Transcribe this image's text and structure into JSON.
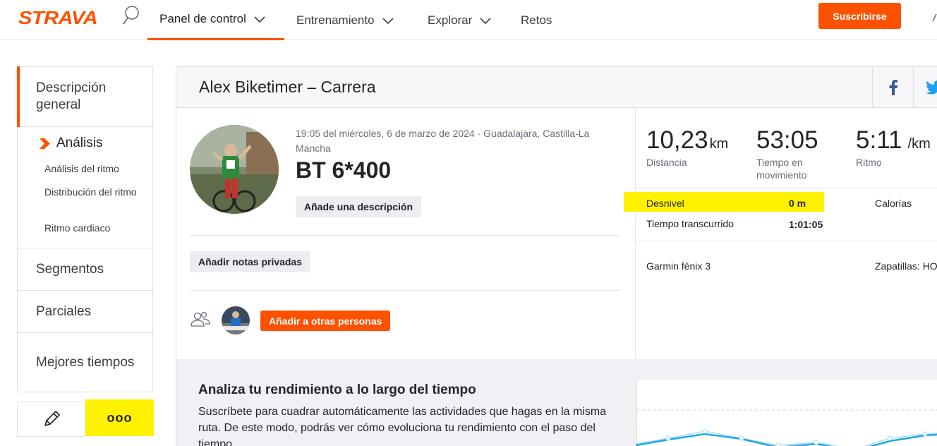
{
  "brand": {
    "logo": "STRAVA",
    "accent": "#fc5200"
  },
  "nav": {
    "items": [
      {
        "label": "Panel de control",
        "has_menu": true,
        "active": true
      },
      {
        "label": "Entrenamiento",
        "has_menu": true,
        "active": false
      },
      {
        "label": "Explorar",
        "has_menu": true,
        "active": false
      },
      {
        "label": "Retos",
        "has_menu": false,
        "active": false
      }
    ],
    "subscribe_label": "Suscribirse"
  },
  "sidebar": {
    "overview_label": "Descripción general",
    "analysis_label": "Análisis",
    "analysis_links": [
      "Análisis del ritmo",
      "Distribución del ritmo",
      "Ritmo cardiaco"
    ],
    "items": [
      "Segmentos",
      "Parciales",
      "Mejores tiempos"
    ],
    "more_label": "ooo"
  },
  "activity": {
    "header_title": "Alex Biketimer – Carrera",
    "meta": "19:05 del miércoles, 6 de marzo de 2024 · Guadalajara, Castilla-La Mancha",
    "name": "BT 6*400",
    "add_description_label": "Añade una descripción",
    "add_private_notes_label": "Añadir notas privadas",
    "add_others_label": "Añadir a otras personas"
  },
  "stats": {
    "distance": {
      "value": "10,23",
      "unit": "km",
      "label": "Distancia"
    },
    "moving_time": {
      "value": "53:05",
      "label": "Tiempo en movimiento"
    },
    "pace": {
      "value": "5:11",
      "unit": "/km",
      "label": "Ritmo"
    },
    "elevation": {
      "label": "Desnivel",
      "value": "0 m"
    },
    "elapsed": {
      "label": "Tiempo transcurrido",
      "value": "1:01:05"
    },
    "calories_label": "Calorías",
    "device": "Garmin fēnix 3",
    "shoes": "Zapatillas: HO"
  },
  "promo": {
    "title": "Analiza tu rendimiento a lo largo del tiempo",
    "text": "Suscríbete para cuadrar automáticamente las actividades que hagas en la misma ruta. De este modo, podrás ver cómo evoluciona tu rendimiento con el paso del tiempo."
  },
  "icons": [
    "search-icon",
    "chevron-down-icon",
    "facebook-icon",
    "twitter-icon",
    "pencil-icon",
    "people-icon",
    "analysis-arrow-icon"
  ],
  "colors": {
    "highlight": "#fff200",
    "panel_bg": "#f0f0f5",
    "chart_line": "#1ea7e6"
  }
}
